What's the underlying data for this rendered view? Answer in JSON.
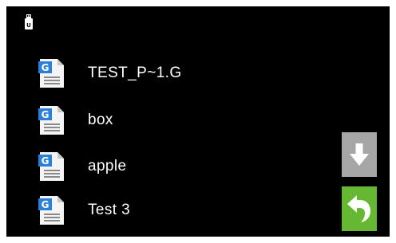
{
  "status_bar": {
    "storage_icon": "usb-drive-icon"
  },
  "files": [
    {
      "name": "TEST_P~1.G",
      "icon": "g-document-icon",
      "icon_letter": "G"
    },
    {
      "name": "box",
      "icon": "g-document-icon",
      "icon_letter": "G"
    },
    {
      "name": "apple",
      "icon": "g-document-icon",
      "icon_letter": "G"
    },
    {
      "name": "Test 3",
      "icon": "g-document-icon",
      "icon_letter": "G"
    }
  ],
  "controls": {
    "scroll_down": {
      "icon": "arrow-down-icon",
      "color": "#a6a6a6"
    },
    "back": {
      "icon": "return-arrow-icon",
      "color": "#66b832"
    }
  },
  "colors": {
    "background": "#000000",
    "text": "#ffffff",
    "icon_accent": "#2c7fd6"
  }
}
